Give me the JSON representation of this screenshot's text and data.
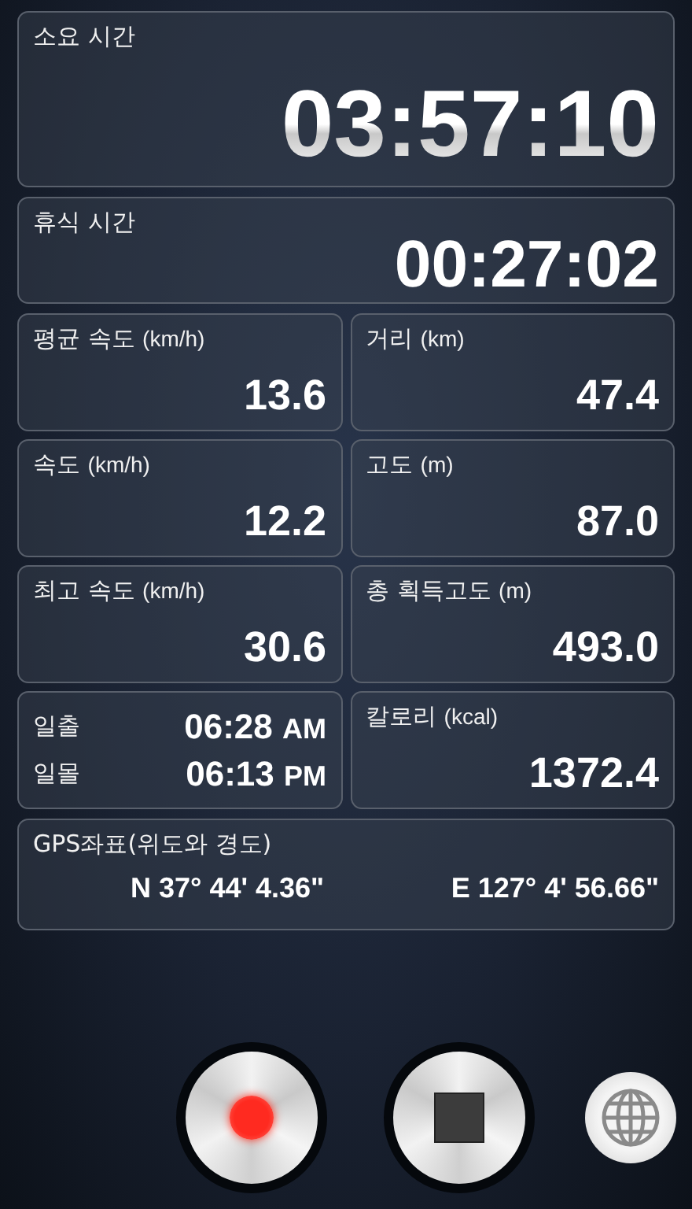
{
  "elapsed": {
    "label": "소요 시간",
    "value": "03:57:10"
  },
  "rest": {
    "label": "휴식 시간",
    "value": "00:27:02"
  },
  "stats": [
    {
      "label": "평균 속도",
      "unit": "(km/h)",
      "value": "13.6"
    },
    {
      "label": "거리",
      "unit": "(km)",
      "value": "47.4"
    },
    {
      "label": "속도",
      "unit": "(km/h)",
      "value": "12.2"
    },
    {
      "label": "고도",
      "unit": "(m)",
      "value": "87.0"
    },
    {
      "label": "최고 속도",
      "unit": "(km/h)",
      "value": "30.6"
    },
    {
      "label": "총 획득고도",
      "unit": "(m)",
      "value": "493.0"
    }
  ],
  "sun": [
    {
      "label": "일출",
      "time": "06:28",
      "period": "AM"
    },
    {
      "label": "일몰",
      "time": "06:13",
      "period": "PM"
    }
  ],
  "calories": {
    "label": "칼로리",
    "unit": "(kcal)",
    "value": "1372.4"
  },
  "gps": {
    "label": "GPS좌표(위도와 경도)",
    "latitude": "N 37° 44' 4.36\"",
    "longitude": "E 127° 4' 56.66\""
  }
}
